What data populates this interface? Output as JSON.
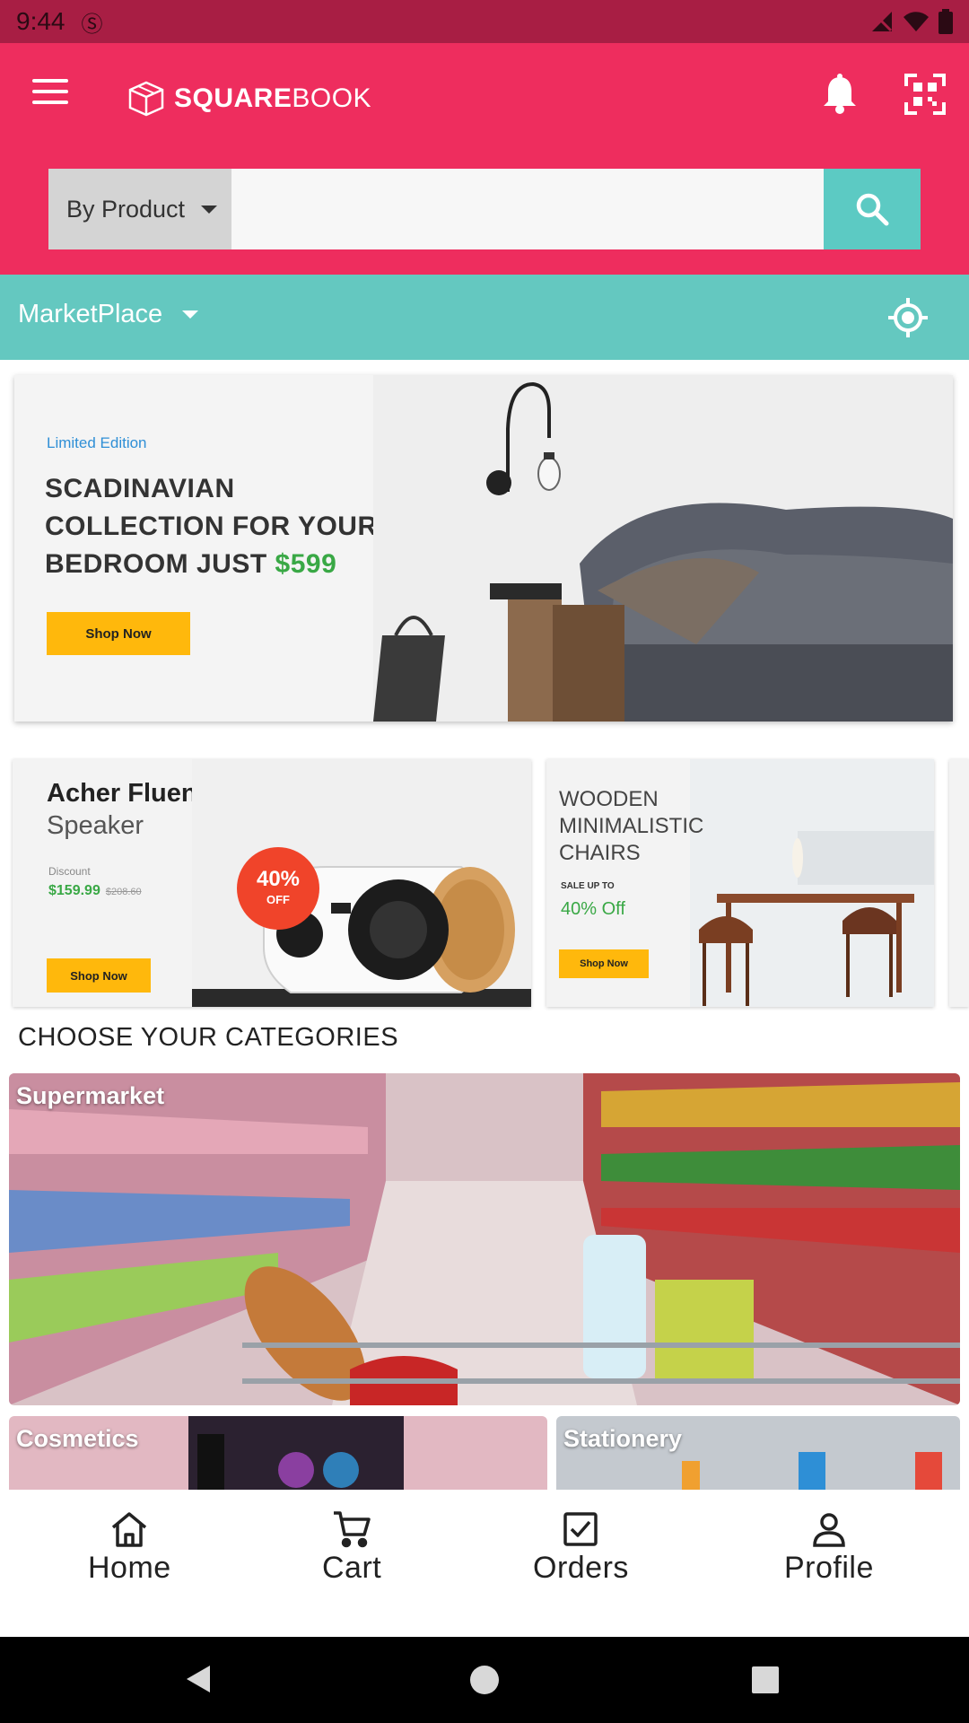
{
  "status_bar": {
    "time": "9:44"
  },
  "header": {
    "logo_bold": "SQUARE",
    "logo_light": "BOOK",
    "search_type": "By Product",
    "search_placeholder": ""
  },
  "market": {
    "label": "MarketPlace"
  },
  "hero": {
    "subtitle": "Limited Edition",
    "title_line1": "SCADINAVIAN",
    "title_line2": "COLLECTION FOR YOUR",
    "title_line3": "BEDROOM JUST",
    "price": "$599",
    "button": "Shop Now"
  },
  "promos": [
    {
      "title_bold": "Acher Fluence",
      "title_rest": " Minimal Speaker",
      "discount_label": "Discount",
      "price": "$159.99",
      "old_price": "$208.60",
      "badge_pct": "40%",
      "badge_off": "OFF",
      "button": "Shop Now"
    },
    {
      "title": "WOODEN MINIMALISTIC CHAIRS",
      "sale": "SALE UP TO",
      "off": "40% Off",
      "button": "Shop Now"
    }
  ],
  "categories": {
    "heading": "CHOOSE YOUR CATEGORIES",
    "items": [
      {
        "label": "Supermarket"
      },
      {
        "label": "Cosmetics"
      },
      {
        "label": "Stationery"
      }
    ]
  },
  "bottom_nav": [
    {
      "label": "Home",
      "icon": "home-icon"
    },
    {
      "label": "Cart",
      "icon": "cart-icon"
    },
    {
      "label": "Orders",
      "icon": "orders-icon"
    },
    {
      "label": "Profile",
      "icon": "profile-icon"
    }
  ],
  "colors": {
    "primary": "#ee2d5e",
    "status_bar": "#a81e44",
    "teal": "#64c8c0",
    "accent_yellow": "#ffb80c",
    "price_green": "#39a845"
  }
}
